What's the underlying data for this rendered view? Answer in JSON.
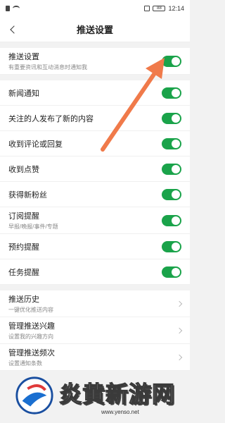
{
  "status_bar": {
    "time": "12:14",
    "battery": "88"
  },
  "header": {
    "title": "推送设置"
  },
  "push_main": {
    "label": "推送设置",
    "sub": "有重要资讯和互动消息时通知我",
    "on": true
  },
  "toggles": [
    {
      "label": "新闻通知",
      "on": true
    },
    {
      "label": "关注的人发布了新的内容",
      "on": true
    },
    {
      "label": "收到评论或回复",
      "on": true
    },
    {
      "label": "收到点赞",
      "on": true
    },
    {
      "label": "获得新粉丝",
      "on": true
    },
    {
      "label": "订阅提醒",
      "sub": "早报/晚报/事件/专题",
      "on": true
    },
    {
      "label": "预约提醒",
      "on": true
    },
    {
      "label": "任务提醒",
      "on": true
    }
  ],
  "links": [
    {
      "label": "推送历史",
      "sub": "一键优化推送内容"
    },
    {
      "label": "管理推送兴趣",
      "sub": "设置我的兴趣方向"
    },
    {
      "label": "管理推送频次",
      "sub": "设置通知条数"
    }
  ],
  "watermark": {
    "text": "炎黄新游网",
    "url": "www.yenso.net"
  },
  "colors": {
    "toggle_on": "#1aa34a",
    "annotation_arrow": "#f07a4a"
  },
  "icons": [
    "back-icon",
    "chevron-right-icon",
    "toggle-switch",
    "annotation-arrow",
    "watermark-logo"
  ]
}
